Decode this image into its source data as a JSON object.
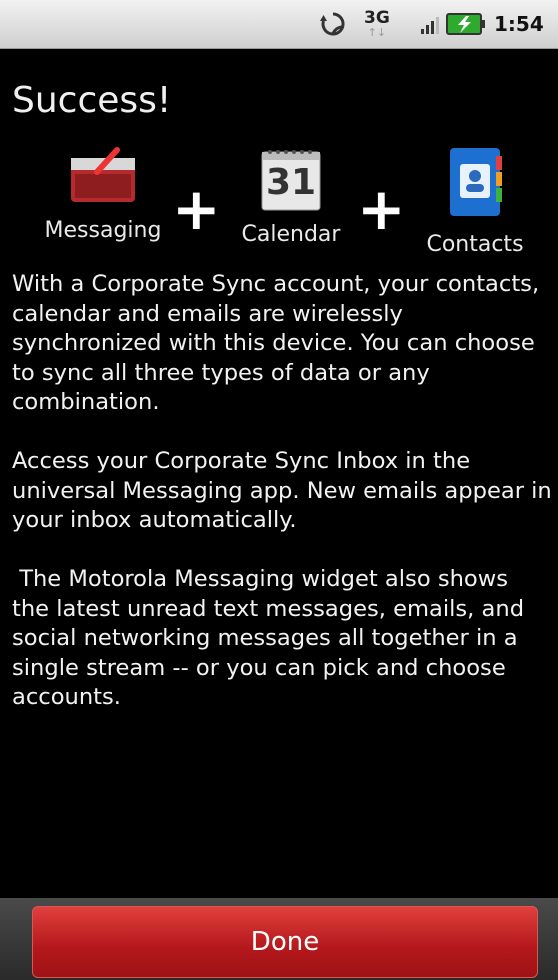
{
  "status_bar": {
    "network_type": "3G",
    "network_arrows": "↑↓",
    "time": "1:54",
    "icons": [
      "sync-icon",
      "signal-icon",
      "battery-charging-icon"
    ]
  },
  "screen": {
    "title": "Success!"
  },
  "apps": [
    {
      "label": "Messaging",
      "icon": "messaging-icon"
    },
    {
      "label": "Calendar",
      "icon": "calendar-icon",
      "day": "31"
    },
    {
      "label": "Contacts",
      "icon": "contacts-icon"
    }
  ],
  "plus_sign": "+",
  "paragraphs": [
    "With a Corporate Sync account, your contacts, calendar and emails are wirelessly synchronized with this device. You can choose to sync all three types of data or any combination.",
    "Access your Corporate Sync Inbox in the universal Messaging app. New emails appear in your inbox automatically.",
    " The Motorola Messaging widget also shows the latest unread text messages, emails, and social networking messages all together in a single stream -- or you can pick and choose accounts."
  ],
  "actions": {
    "done_label": "Done"
  },
  "colors": {
    "background": "#000000",
    "done_button": "#c0201f"
  }
}
